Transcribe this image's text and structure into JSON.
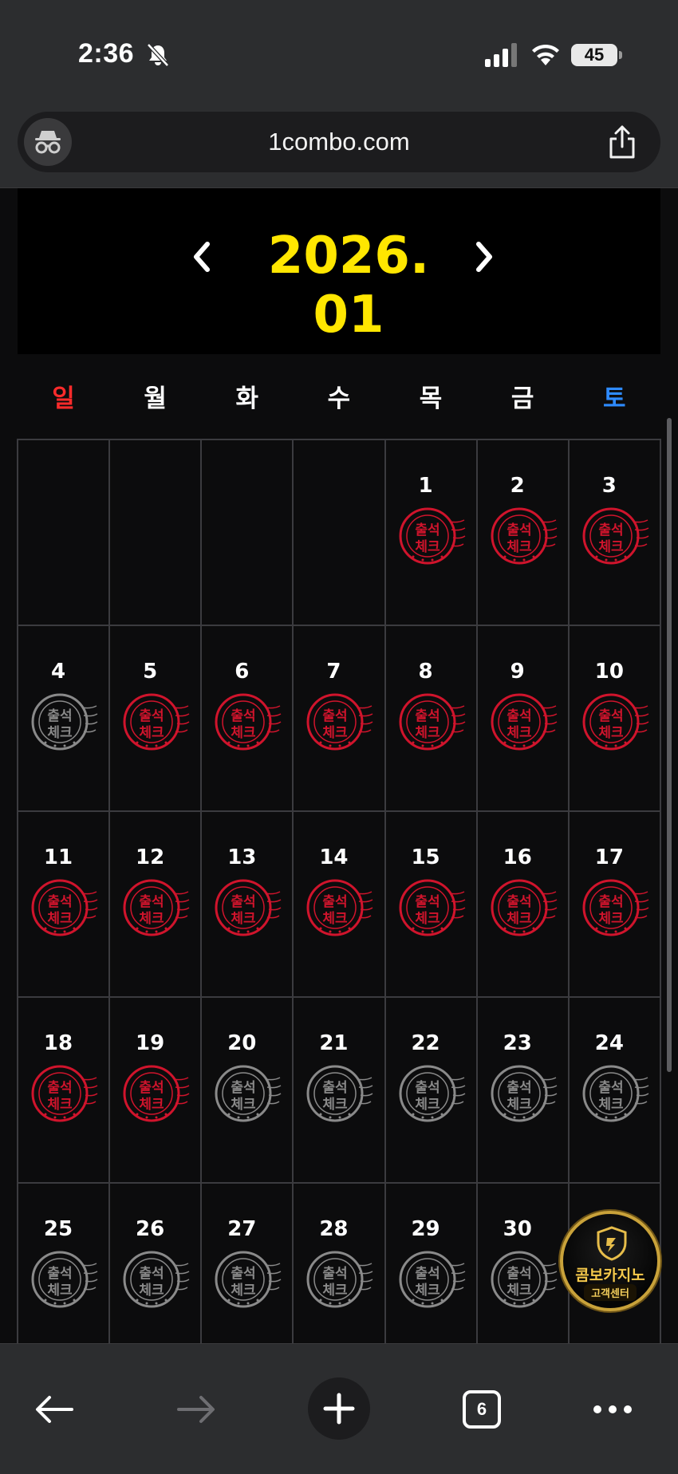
{
  "status_bar": {
    "time": "2:36",
    "battery": "45"
  },
  "browser": {
    "url": "1combo.com",
    "tab_count": "6"
  },
  "calendar": {
    "month_title": "2026. 01",
    "weekdays": [
      "일",
      "월",
      "화",
      "수",
      "목",
      "금",
      "토"
    ],
    "stamp_text_top": "출석",
    "stamp_text_bottom": "체크",
    "leading_blanks": 4,
    "days": [
      {
        "day": "1",
        "stamp": "red"
      },
      {
        "day": "2",
        "stamp": "red"
      },
      {
        "day": "3",
        "stamp": "red"
      },
      {
        "day": "4",
        "stamp": "gray"
      },
      {
        "day": "5",
        "stamp": "red"
      },
      {
        "day": "6",
        "stamp": "red"
      },
      {
        "day": "7",
        "stamp": "red"
      },
      {
        "day": "8",
        "stamp": "red"
      },
      {
        "day": "9",
        "stamp": "red"
      },
      {
        "day": "10",
        "stamp": "red"
      },
      {
        "day": "11",
        "stamp": "red"
      },
      {
        "day": "12",
        "stamp": "red"
      },
      {
        "day": "13",
        "stamp": "red"
      },
      {
        "day": "14",
        "stamp": "red"
      },
      {
        "day": "15",
        "stamp": "red"
      },
      {
        "day": "16",
        "stamp": "red"
      },
      {
        "day": "17",
        "stamp": "red"
      },
      {
        "day": "18",
        "stamp": "red"
      },
      {
        "day": "19",
        "stamp": "red"
      },
      {
        "day": "20",
        "stamp": "gray"
      },
      {
        "day": "21",
        "stamp": "gray"
      },
      {
        "day": "22",
        "stamp": "gray"
      },
      {
        "day": "23",
        "stamp": "gray"
      },
      {
        "day": "24",
        "stamp": "gray"
      },
      {
        "day": "25",
        "stamp": "gray"
      },
      {
        "day": "26",
        "stamp": "gray"
      },
      {
        "day": "27",
        "stamp": "gray"
      },
      {
        "day": "28",
        "stamp": "gray"
      },
      {
        "day": "29",
        "stamp": "gray"
      },
      {
        "day": "30",
        "stamp": "gray"
      },
      {
        "day": "",
        "stamp": "none"
      }
    ]
  },
  "customer_service": {
    "name": "콤보카지노",
    "label": "고객센터"
  },
  "colors": {
    "title_yellow": "#ffe600",
    "sunday_red": "#ff2b2b",
    "saturday_blue": "#2e8bff",
    "stamp_red": "#d0142c",
    "stamp_gray": "#8a8a8a"
  }
}
